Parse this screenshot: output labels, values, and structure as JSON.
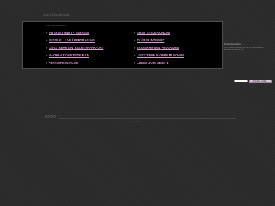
{
  "header": {
    "domain_title": "gozzip.business"
  },
  "links_panel": {
    "heading": "Links zu gozzip.business",
    "left_column": [
      "INTERNET UND TV ZUHAUSE",
      "FUSSBALL LIVE ÜBERTRAGUNG",
      "LIVESTREAM EINTRACHT FRANKFURT",
      "NACHHALTIGKEITSZIELE UN",
      "FERNSEHEN ONLINE"
    ],
    "right_column": [
      "SMARTSTEUER ONLINE",
      "TV ÜBER INTERNET",
      "TRANSKRIPTION PROGRAMM",
      "LIVESTREAM BAYERN MÜNCHEN",
      "CHRISTLICHE GEBETE"
    ],
    "bullet": "»"
  },
  "sidebar": {
    "title": "Related searches",
    "text": "This is a domain parking page. The links are provided for informational purposes only."
  },
  "search": {
    "placeholder": "",
    "button_label": "Ähnlicher Suchbe..."
  },
  "footer": {
    "logo": "sedo",
    "link": "Privacy Policy"
  },
  "colors": {
    "background": "#2a2a2a",
    "panel": "#000000",
    "link": "#d79ad3",
    "button": "#d9c6d8"
  }
}
